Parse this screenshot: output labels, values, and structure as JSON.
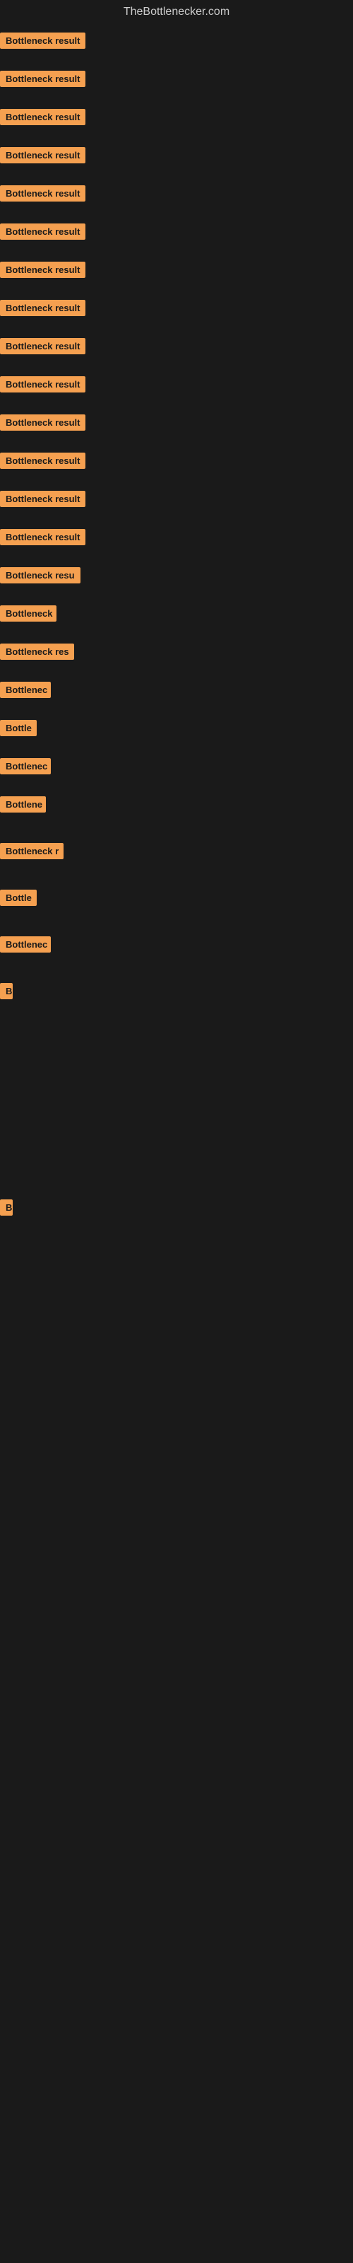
{
  "site": {
    "title": "TheBottlenecker.com"
  },
  "items": [
    {
      "id": 1,
      "label": "Bottleneck result",
      "badge_width": 130
    },
    {
      "id": 2,
      "label": "Bottleneck result",
      "badge_width": 130
    },
    {
      "id": 3,
      "label": "Bottleneck result",
      "badge_width": 130
    },
    {
      "id": 4,
      "label": "Bottleneck result",
      "badge_width": 130
    },
    {
      "id": 5,
      "label": "Bottleneck result",
      "badge_width": 130
    },
    {
      "id": 6,
      "label": "Bottleneck result",
      "badge_width": 130
    },
    {
      "id": 7,
      "label": "Bottleneck result",
      "badge_width": 130
    },
    {
      "id": 8,
      "label": "Bottleneck result",
      "badge_width": 130
    },
    {
      "id": 9,
      "label": "Bottleneck result",
      "badge_width": 130
    },
    {
      "id": 10,
      "label": "Bottleneck result",
      "badge_width": 130
    },
    {
      "id": 11,
      "label": "Bottleneck result",
      "badge_width": 130
    },
    {
      "id": 12,
      "label": "Bottleneck result",
      "badge_width": 130
    },
    {
      "id": 13,
      "label": "Bottleneck result",
      "badge_width": 130
    },
    {
      "id": 14,
      "label": "Bottleneck result",
      "badge_width": 130
    },
    {
      "id": 15,
      "label": "Bottleneck resu",
      "badge_width": 115
    },
    {
      "id": 16,
      "label": "Bottleneck",
      "badge_width": 80
    },
    {
      "id": 17,
      "label": "Bottleneck res",
      "badge_width": 105
    },
    {
      "id": 18,
      "label": "Bottlenec",
      "badge_width": 72
    },
    {
      "id": 19,
      "label": "Bottle",
      "badge_width": 52
    },
    {
      "id": 20,
      "label": "Bottlenec",
      "badge_width": 72
    },
    {
      "id": 21,
      "label": "Bottlene",
      "badge_width": 65
    },
    {
      "id": 22,
      "label": "Bottleneck r",
      "badge_width": 90
    },
    {
      "id": 23,
      "label": "Bottle",
      "badge_width": 52
    },
    {
      "id": 24,
      "label": "Bottlenec",
      "badge_width": 72
    },
    {
      "id": 25,
      "label": "B",
      "badge_width": 18
    },
    {
      "id": 26,
      "label": "",
      "badge_width": 0
    },
    {
      "id": 27,
      "label": "",
      "badge_width": 0
    },
    {
      "id": 28,
      "label": "",
      "badge_width": 0
    },
    {
      "id": 29,
      "label": "B",
      "badge_width": 18
    },
    {
      "id": 30,
      "label": "",
      "badge_width": 0
    },
    {
      "id": 31,
      "label": "",
      "badge_width": 0
    },
    {
      "id": 32,
      "label": "",
      "badge_width": 0
    },
    {
      "id": 33,
      "label": "",
      "badge_width": 0
    }
  ]
}
